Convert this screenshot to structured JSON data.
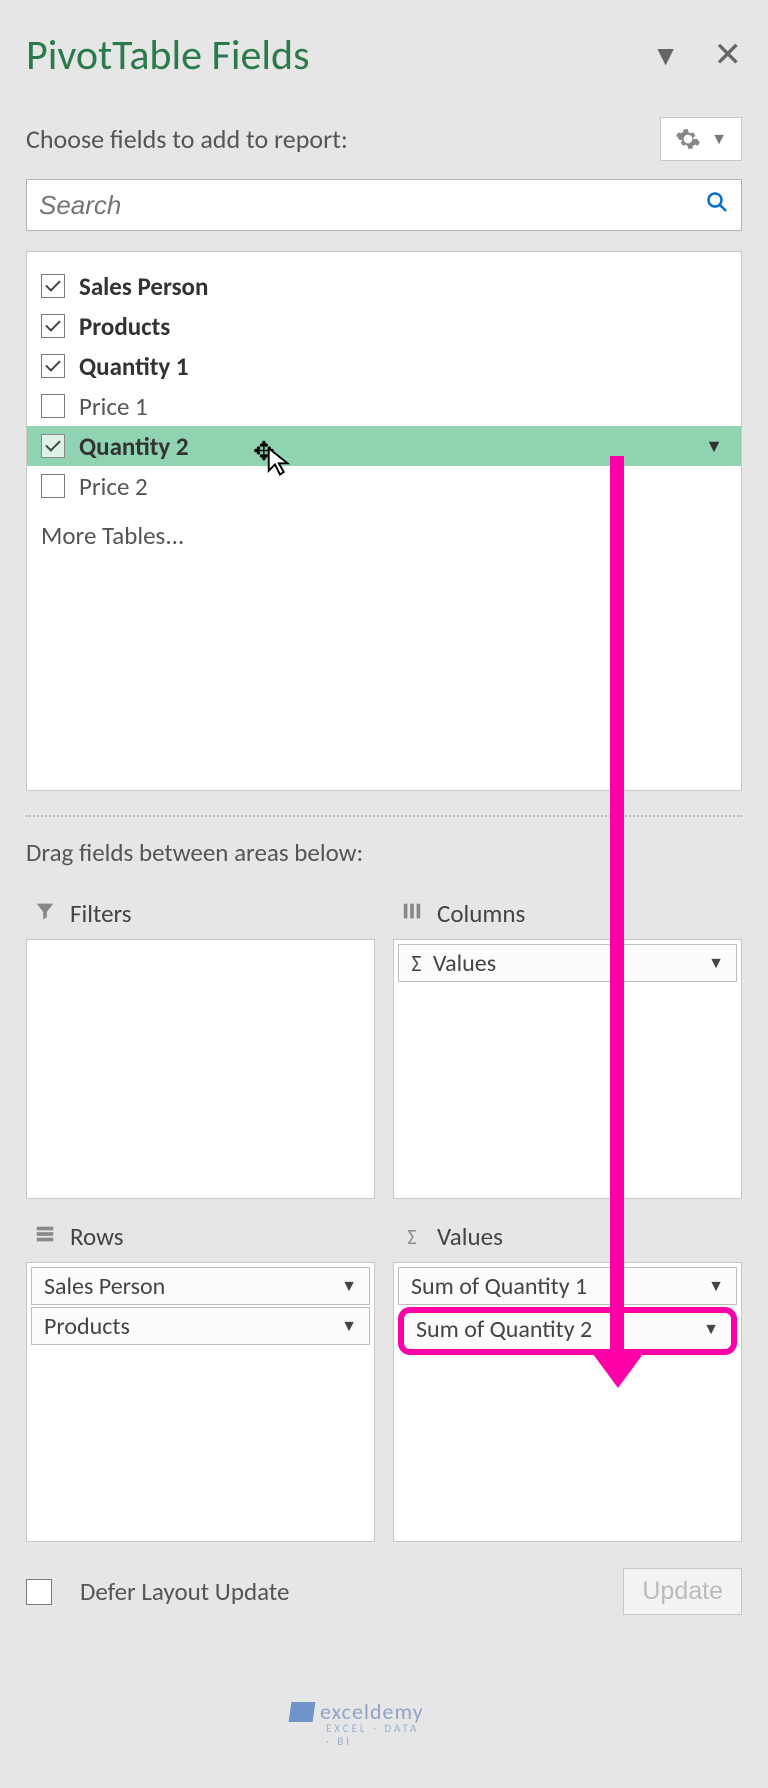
{
  "header": {
    "title": "PivotTable Fields"
  },
  "choose_label": "Choose fields to add to report:",
  "search": {
    "placeholder": "Search"
  },
  "fields": [
    {
      "label": "Sales Person",
      "checked": true,
      "bold": true
    },
    {
      "label": "Products",
      "checked": true,
      "bold": true
    },
    {
      "label": "Quantity 1",
      "checked": true,
      "bold": true
    },
    {
      "label": "Price 1",
      "checked": false,
      "bold": false
    },
    {
      "label": "Quantity 2",
      "checked": true,
      "bold": true,
      "highlight": true
    },
    {
      "label": "Price 2",
      "checked": false,
      "bold": false
    }
  ],
  "more_tables": "More Tables...",
  "drag_label": "Drag fields between areas below:",
  "areas": {
    "filters": {
      "title": "Filters",
      "items": []
    },
    "columns": {
      "title": "Columns",
      "items": [
        "Values"
      ]
    },
    "rows": {
      "title": "Rows",
      "items": [
        "Sales Person",
        "Products"
      ]
    },
    "values": {
      "title": "Values",
      "items": [
        "Sum of Quantity 1",
        "Sum of Quantity 2"
      ]
    }
  },
  "footer": {
    "defer_label": "Defer Layout Update",
    "update_label": "Update"
  },
  "watermark": {
    "brand": "exceldemy",
    "sub": "EXCEL · DATA · BI"
  }
}
